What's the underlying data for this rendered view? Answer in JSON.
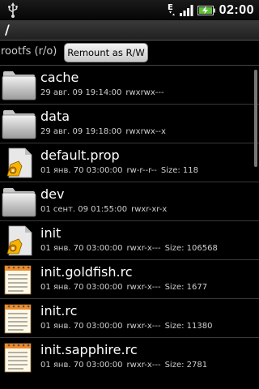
{
  "status": {
    "time": "02:00",
    "data_indicator": "E"
  },
  "path": "/",
  "mount": {
    "label": "rootfs (r/o)",
    "button": "Remount as R/W"
  },
  "files": [
    {
      "name": "cache",
      "type": "folder",
      "date": "29 авг. 09 19:14:00",
      "perms": "rwxrwx---",
      "size": ""
    },
    {
      "name": "data",
      "type": "folder",
      "date": "29 авг. 09 19:18:00",
      "perms": "rwxrwx--x",
      "size": ""
    },
    {
      "name": "default.prop",
      "type": "system-file",
      "date": "01 янв. 70 03:00:00",
      "perms": "rw-r--r--",
      "size": "Size: 118"
    },
    {
      "name": "dev",
      "type": "folder",
      "date": "01 сент. 09 01:55:00",
      "perms": "rwxr-xr-x",
      "size": ""
    },
    {
      "name": "init",
      "type": "system-file",
      "date": "01 янв. 70 03:00:00",
      "perms": "rwxr-x---",
      "size": "Size: 106568"
    },
    {
      "name": "init.goldfish.rc",
      "type": "text-file",
      "date": "01 янв. 70 03:00:00",
      "perms": "rwxr-x---",
      "size": "Size: 1677"
    },
    {
      "name": "init.rc",
      "type": "text-file",
      "date": "01 янв. 70 03:00:00",
      "perms": "rwxr-x---",
      "size": "Size: 11380"
    },
    {
      "name": "init.sapphire.rc",
      "type": "text-file",
      "date": "01 янв. 70 03:00:00",
      "perms": "rwxr-x---",
      "size": "Size: 2781"
    }
  ]
}
